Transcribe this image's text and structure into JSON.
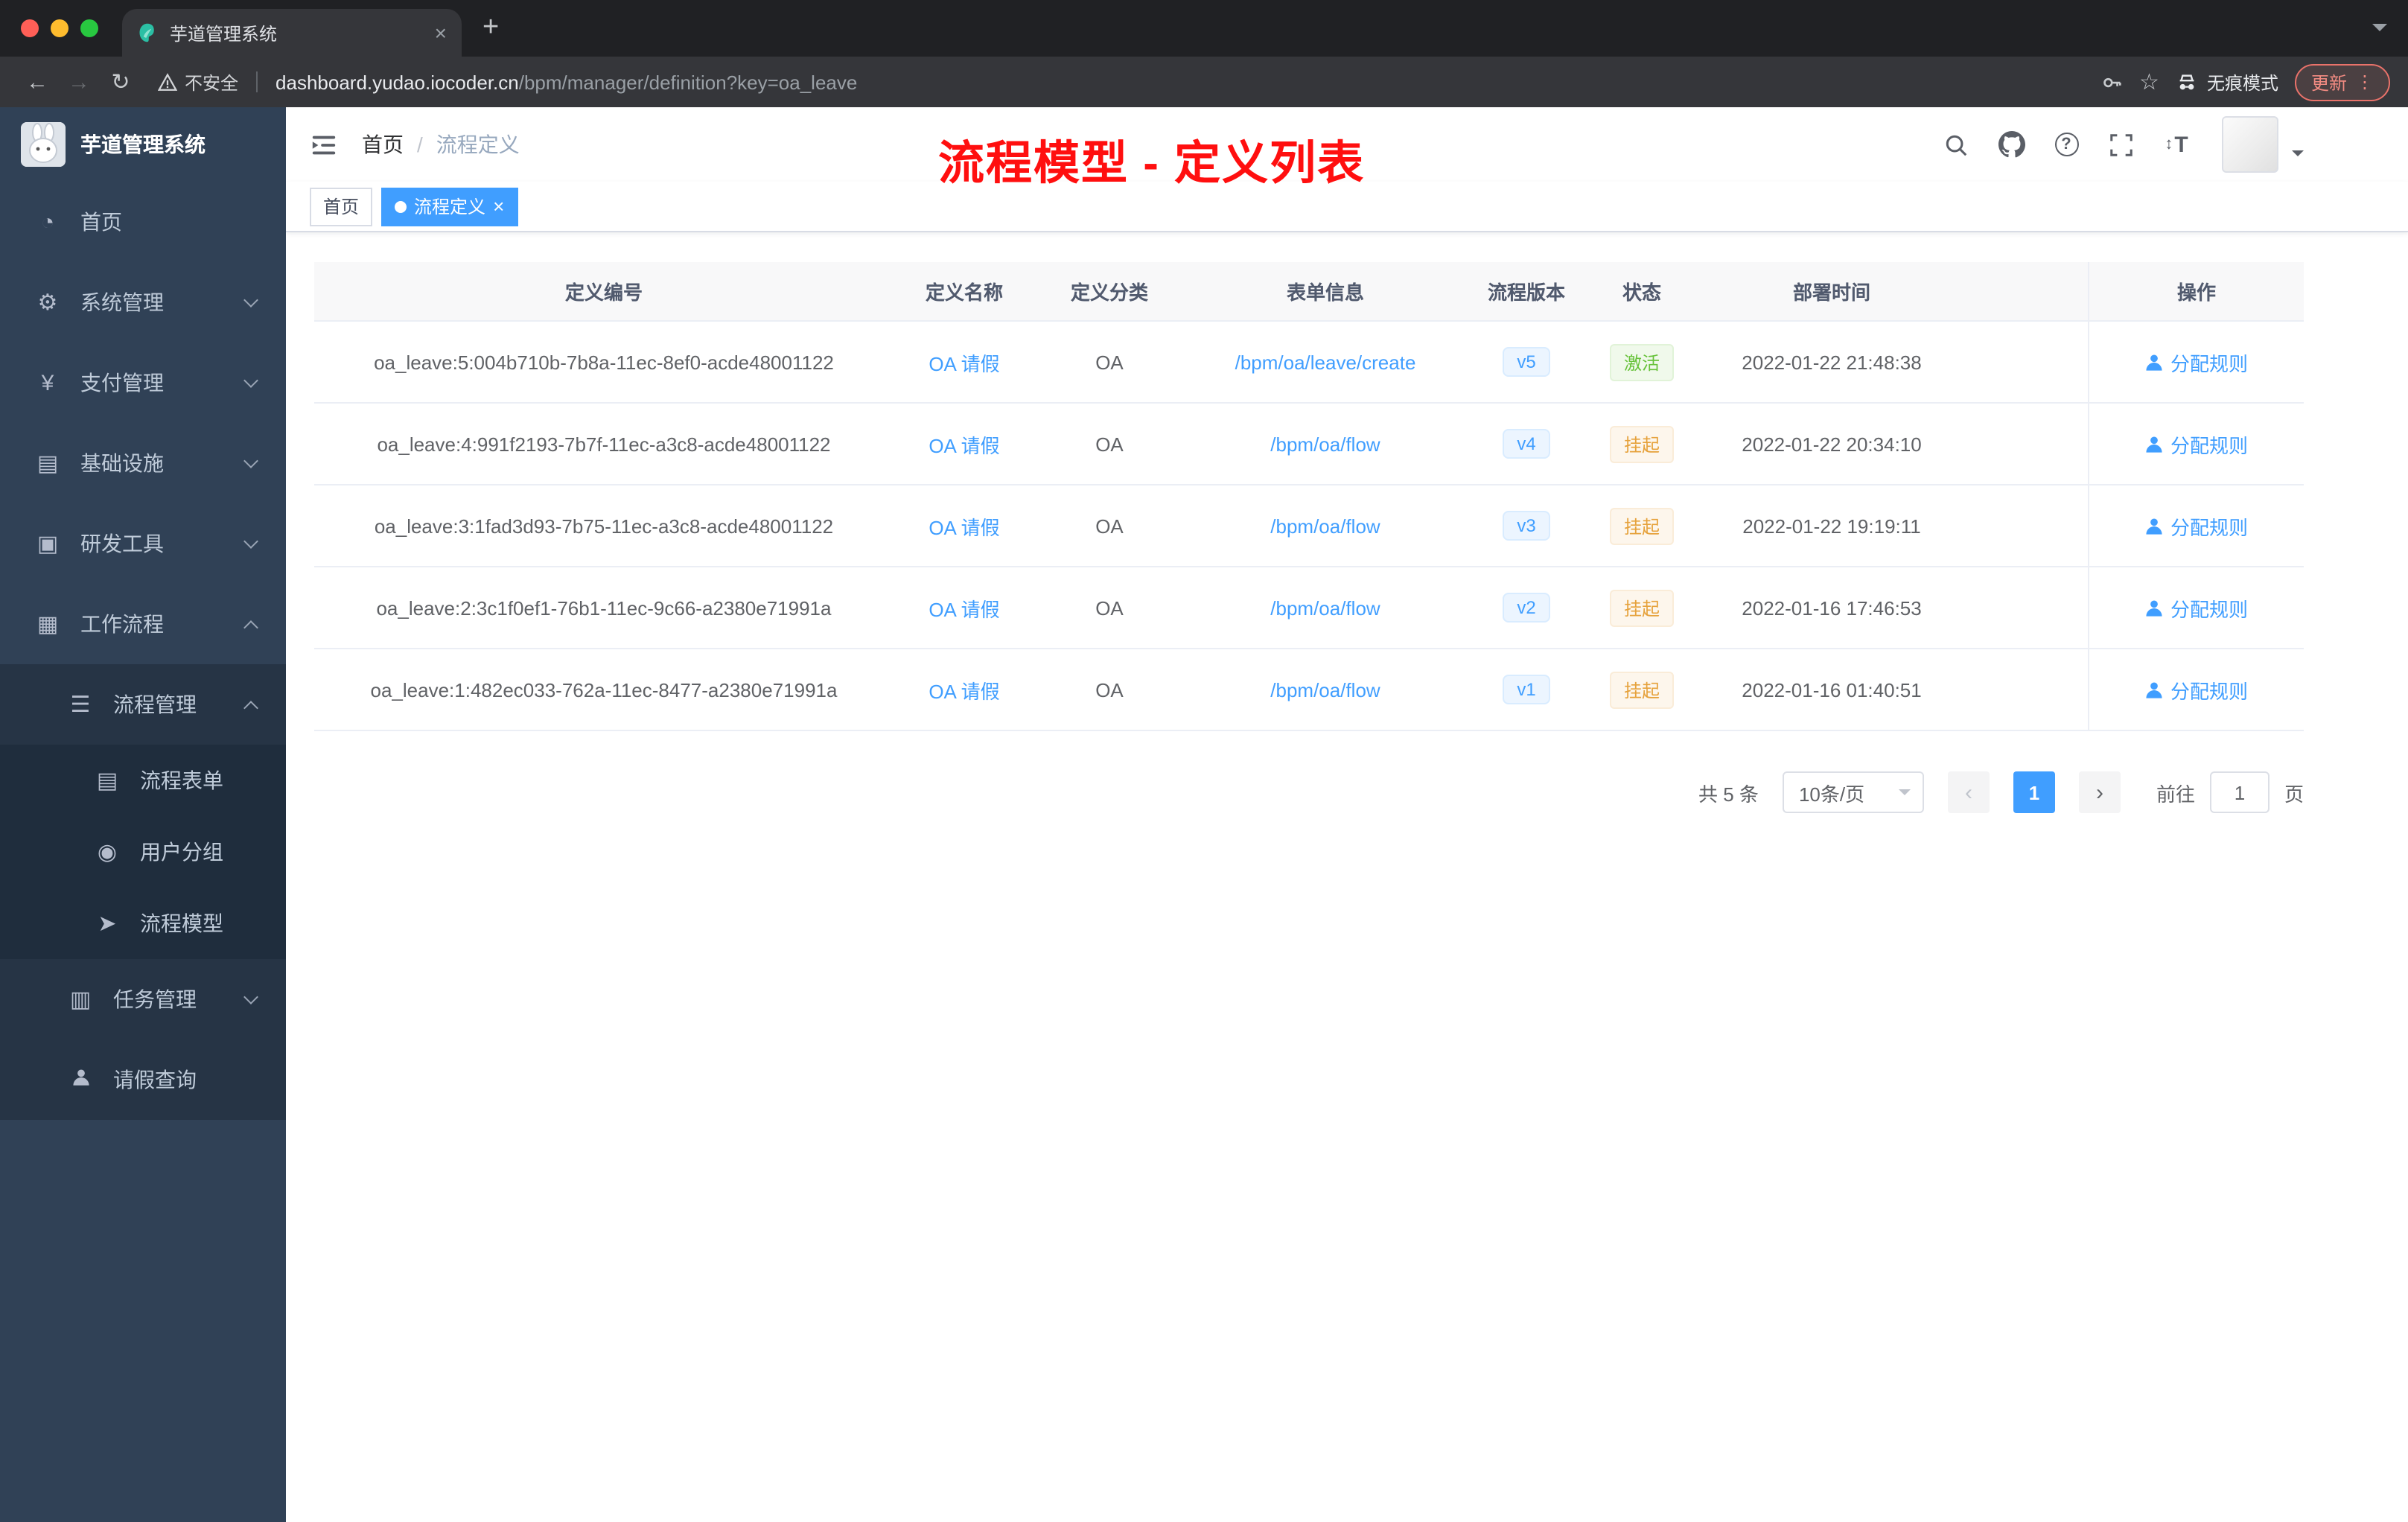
{
  "browser": {
    "tab_title": "芋道管理系统",
    "security_label": "不安全",
    "url_domain": "dashboard.yudao.iocoder.cn",
    "url_path": "/bpm/manager/definition?key=oa_leave",
    "incognito_label": "无痕模式",
    "update_label": "更新"
  },
  "sidebar": {
    "logo_title": "芋道管理系统",
    "items": [
      {
        "name": "home",
        "label": "首页",
        "icon": "dashboard",
        "level": 1
      },
      {
        "name": "system-management",
        "label": "系统管理",
        "icon": "gear",
        "level": 1,
        "arrow": "down"
      },
      {
        "name": "payment-management",
        "label": "支付管理",
        "icon": "yen",
        "level": 1,
        "arrow": "down"
      },
      {
        "name": "infrastructure",
        "label": "基础设施",
        "icon": "infra",
        "level": 1,
        "arrow": "down"
      },
      {
        "name": "dev-tools",
        "label": "研发工具",
        "icon": "tools",
        "level": 1,
        "arrow": "down"
      },
      {
        "name": "workflow",
        "label": "工作流程",
        "icon": "workflow",
        "level": 1,
        "arrow": "up"
      },
      {
        "name": "process-management",
        "label": "流程管理",
        "icon": "process",
        "level": 2,
        "arrow": "up"
      },
      {
        "name": "process-form",
        "label": "流程表单",
        "icon": "form",
        "level": 3
      },
      {
        "name": "user-group",
        "label": "用户分组",
        "icon": "group",
        "level": 3
      },
      {
        "name": "process-model",
        "label": "流程模型",
        "icon": "model",
        "level": 3
      },
      {
        "name": "task-management",
        "label": "任务管理",
        "icon": "task",
        "level": 2,
        "arrow": "down"
      },
      {
        "name": "leave-query",
        "label": "请假查询",
        "icon": "user",
        "level": 2
      }
    ]
  },
  "header": {
    "breadcrumb": {
      "home": "首页",
      "separator": "/",
      "current": "流程定义"
    },
    "annotation": "流程模型 - 定义列表",
    "icons": [
      "search-icon",
      "github-icon",
      "question-icon",
      "fullscreen-icon",
      "font-size-icon",
      "avatar"
    ]
  },
  "tags": [
    {
      "label": "首页",
      "active": false
    },
    {
      "label": "流程定义",
      "active": true
    }
  ],
  "table": {
    "columns": [
      "定义编号",
      "定义名称",
      "定义分类",
      "表单信息",
      "流程版本",
      "状态",
      "部署时间",
      "操作"
    ],
    "rows": [
      {
        "id": "oa_leave:5:004b710b-7b8a-11ec-8ef0-acde48001122",
        "name": "OA 请假",
        "category": "OA",
        "form": "/bpm/oa/leave/create",
        "version": "v5",
        "status": "激活",
        "status_type": "success",
        "deploy_time": "2022-01-22 21:48:38",
        "action": "分配规则"
      },
      {
        "id": "oa_leave:4:991f2193-7b7f-11ec-a3c8-acde48001122",
        "name": "OA 请假",
        "category": "OA",
        "form": "/bpm/oa/flow",
        "version": "v4",
        "status": "挂起",
        "status_type": "warning",
        "deploy_time": "2022-01-22 20:34:10",
        "action": "分配规则"
      },
      {
        "id": "oa_leave:3:1fad3d93-7b75-11ec-a3c8-acde48001122",
        "name": "OA 请假",
        "category": "OA",
        "form": "/bpm/oa/flow",
        "version": "v3",
        "status": "挂起",
        "status_type": "warning",
        "deploy_time": "2022-01-22 19:19:11",
        "action": "分配规则"
      },
      {
        "id": "oa_leave:2:3c1f0ef1-76b1-11ec-9c66-a2380e71991a",
        "name": "OA 请假",
        "category": "OA",
        "form": "/bpm/oa/flow",
        "version": "v2",
        "status": "挂起",
        "status_type": "warning",
        "deploy_time": "2022-01-16 17:46:53",
        "action": "分配规则"
      },
      {
        "id": "oa_leave:1:482ec033-762a-11ec-8477-a2380e71991a",
        "name": "OA 请假",
        "category": "OA",
        "form": "/bpm/oa/flow",
        "version": "v1",
        "status": "挂起",
        "status_type": "warning",
        "deploy_time": "2022-01-16 01:40:51",
        "action": "分配规则"
      }
    ]
  },
  "pagination": {
    "total_label": "共 5 条",
    "page_size_label": "10条/页",
    "current_page": "1",
    "goto_label": "前往",
    "goto_value": "1",
    "page_unit": "页"
  },
  "colors": {
    "accent": "#409eff",
    "sidebar_bg": "#304156",
    "annotation_red": "#ff0f0f",
    "success": "#67c23a",
    "warning": "#e6a23c"
  }
}
